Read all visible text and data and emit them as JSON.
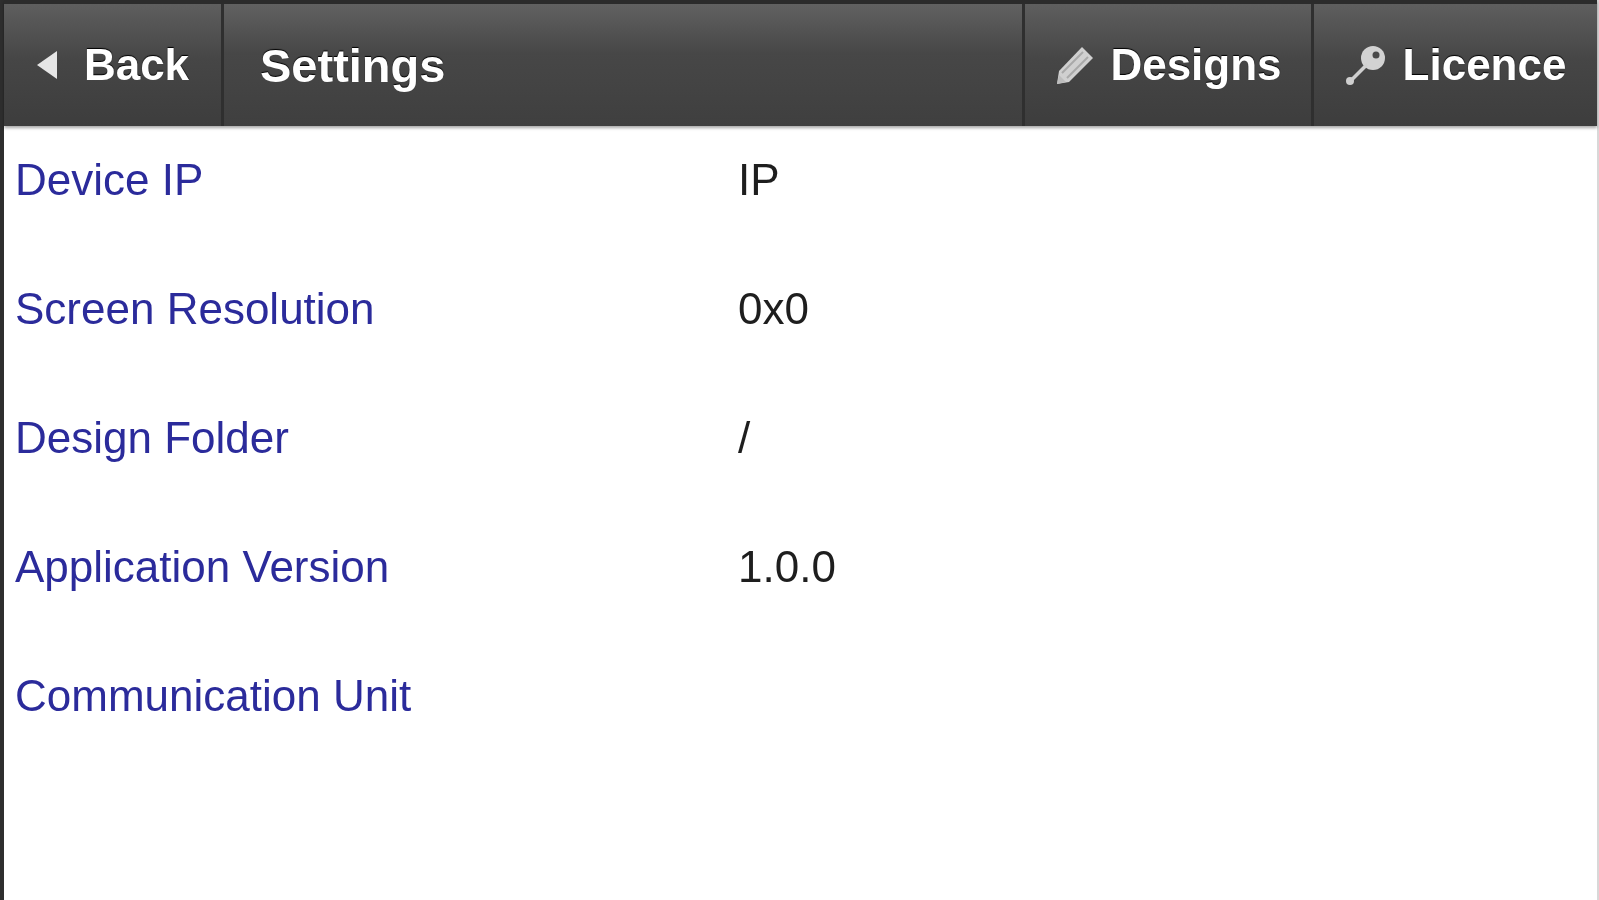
{
  "header": {
    "back_button": "Back",
    "title": "Settings",
    "designs_button": "Designs",
    "licence_button": "Licence"
  },
  "settings": [
    {
      "label": "Device IP",
      "value": "IP"
    },
    {
      "label": "Screen Resolution",
      "value": "0x0"
    },
    {
      "label": "Design Folder",
      "value": "/"
    },
    {
      "label": "Application Version",
      "value": "1.0.0"
    },
    {
      "label": "Communication Unit"
    }
  ]
}
